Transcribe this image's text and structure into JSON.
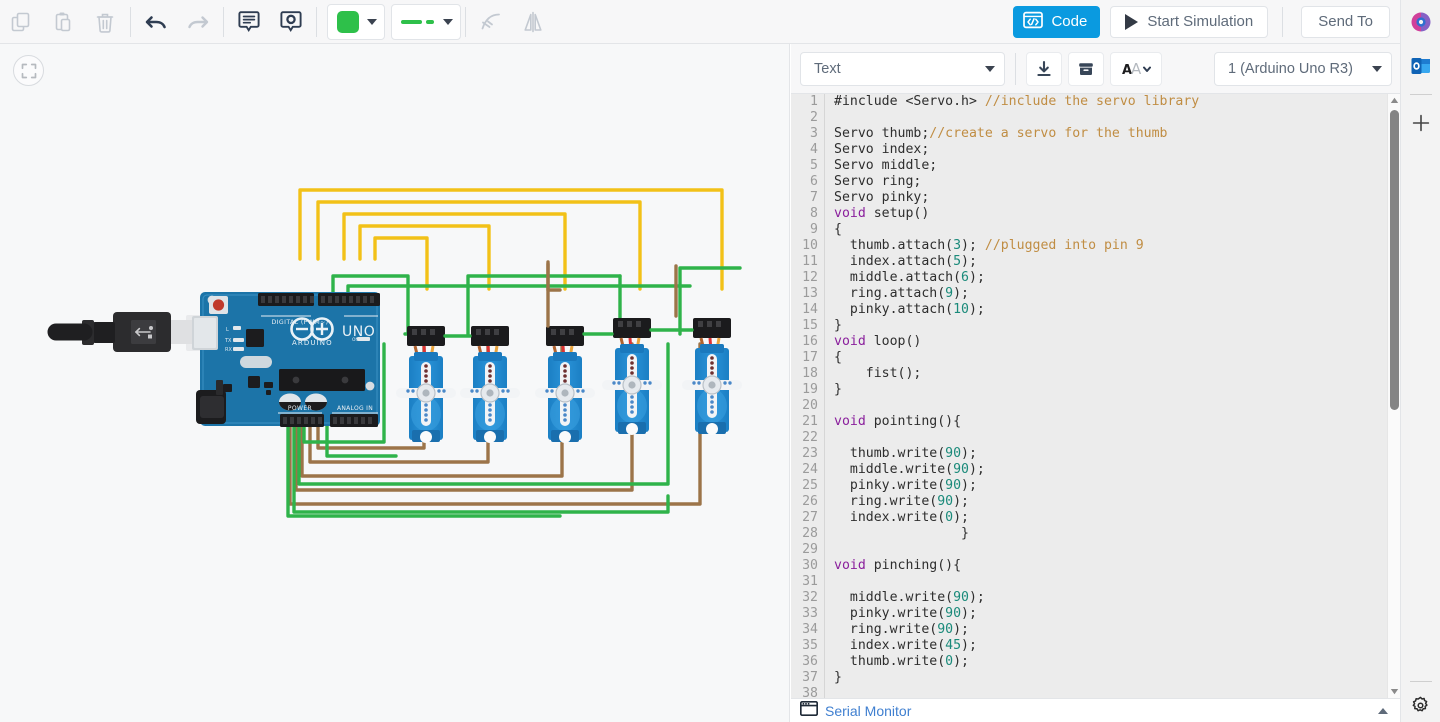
{
  "toolbar": {
    "left_tools": [
      {
        "name": "copy-icon",
        "title": "Copy"
      },
      {
        "name": "paste-icon",
        "title": "Paste"
      },
      {
        "name": "delete-icon",
        "title": "Delete"
      },
      {
        "name": "undo-icon",
        "title": "Undo"
      },
      {
        "name": "redo-icon",
        "title": "Redo"
      },
      {
        "name": "annotation-icon",
        "title": "Annotation"
      },
      {
        "name": "inspect-icon",
        "title": "Inspect"
      }
    ],
    "wire_color_hex": "#2ec04a",
    "right_tools": [
      {
        "name": "bend-wire-icon",
        "title": "Bend Wire"
      },
      {
        "name": "flip-icon",
        "title": "Flip"
      }
    ],
    "code_label": "Code",
    "start_simulation_label": "Start Simulation",
    "send_to_label": "Send To",
    "accent_hex": "#0a9ae0"
  },
  "canvas": {
    "fit_button_name": "fit-to-view",
    "board_label_brand": "ARDUINO",
    "board_label_model": "UNO",
    "board_header_digital": "DIGITAL (PWM~)",
    "board_header_power": "POWER",
    "board_header_analog": "ANALOG IN",
    "board_color_hex": "#1c74a8",
    "servo_color_hex": "#1b7fc4",
    "wire_signal_hex": "#f2c118",
    "wire_power_hex": "#2fb34a",
    "wire_ground_hex": "#9c7449",
    "servo_count": 5
  },
  "panel": {
    "mode_label": "Text",
    "download_icon": "download-icon",
    "library_icon": "library-icon",
    "font_size_icon": "font-size-icon",
    "board_selector_label": "1 (Arduino Uno R3)",
    "serial_monitor_label": "Serial Monitor"
  },
  "code": {
    "total_lines": 38,
    "lines": [
      {
        "n": 1,
        "tokens": [
          {
            "t": "#include <Servo.h> ",
            "c": ""
          },
          {
            "t": "//include the servo library",
            "c": "tok-cmt"
          }
        ]
      },
      {
        "n": 2,
        "tokens": [
          {
            "t": "",
            "c": ""
          }
        ]
      },
      {
        "n": 3,
        "tokens": [
          {
            "t": "Servo thumb;",
            "c": ""
          },
          {
            "t": "//create a servo for the thumb",
            "c": "tok-cmt"
          }
        ]
      },
      {
        "n": 4,
        "tokens": [
          {
            "t": "Servo index;",
            "c": ""
          }
        ]
      },
      {
        "n": 5,
        "tokens": [
          {
            "t": "Servo middle;",
            "c": ""
          }
        ]
      },
      {
        "n": 6,
        "tokens": [
          {
            "t": "Servo ring;",
            "c": ""
          }
        ]
      },
      {
        "n": 7,
        "tokens": [
          {
            "t": "Servo pinky;",
            "c": ""
          }
        ]
      },
      {
        "n": 8,
        "tokens": [
          {
            "t": "void",
            "c": "tok-kw"
          },
          {
            "t": " setup()",
            "c": ""
          }
        ]
      },
      {
        "n": 9,
        "tokens": [
          {
            "t": "{",
            "c": ""
          }
        ]
      },
      {
        "n": 10,
        "tokens": [
          {
            "t": "  thumb.attach(",
            "c": ""
          },
          {
            "t": "3",
            "c": "tok-num"
          },
          {
            "t": "); ",
            "c": ""
          },
          {
            "t": "//plugged into pin 9",
            "c": "tok-cmt"
          }
        ]
      },
      {
        "n": 11,
        "tokens": [
          {
            "t": "  index.attach(",
            "c": ""
          },
          {
            "t": "5",
            "c": "tok-num"
          },
          {
            "t": ");",
            "c": ""
          }
        ]
      },
      {
        "n": 12,
        "tokens": [
          {
            "t": "  middle.attach(",
            "c": ""
          },
          {
            "t": "6",
            "c": "tok-num"
          },
          {
            "t": ");",
            "c": ""
          }
        ]
      },
      {
        "n": 13,
        "tokens": [
          {
            "t": "  ring.attach(",
            "c": ""
          },
          {
            "t": "9",
            "c": "tok-num"
          },
          {
            "t": ");",
            "c": ""
          }
        ]
      },
      {
        "n": 14,
        "tokens": [
          {
            "t": "  pinky.attach(",
            "c": ""
          },
          {
            "t": "10",
            "c": "tok-num"
          },
          {
            "t": ");",
            "c": ""
          }
        ]
      },
      {
        "n": 15,
        "tokens": [
          {
            "t": "}",
            "c": ""
          }
        ]
      },
      {
        "n": 16,
        "tokens": [
          {
            "t": "void",
            "c": "tok-kw"
          },
          {
            "t": " loop()",
            "c": ""
          }
        ]
      },
      {
        "n": 17,
        "tokens": [
          {
            "t": "{",
            "c": ""
          }
        ]
      },
      {
        "n": 18,
        "tokens": [
          {
            "t": "    fist();",
            "c": ""
          }
        ]
      },
      {
        "n": 19,
        "tokens": [
          {
            "t": "}",
            "c": ""
          }
        ]
      },
      {
        "n": 20,
        "tokens": [
          {
            "t": "",
            "c": ""
          }
        ]
      },
      {
        "n": 21,
        "tokens": [
          {
            "t": "void",
            "c": "tok-kw"
          },
          {
            "t": " pointing(){",
            "c": ""
          }
        ]
      },
      {
        "n": 22,
        "tokens": [
          {
            "t": "",
            "c": ""
          }
        ]
      },
      {
        "n": 23,
        "tokens": [
          {
            "t": "  thumb.write(",
            "c": ""
          },
          {
            "t": "90",
            "c": "tok-num"
          },
          {
            "t": ");",
            "c": ""
          }
        ]
      },
      {
        "n": 24,
        "tokens": [
          {
            "t": "  middle.write(",
            "c": ""
          },
          {
            "t": "90",
            "c": "tok-num"
          },
          {
            "t": ");",
            "c": ""
          }
        ]
      },
      {
        "n": 25,
        "tokens": [
          {
            "t": "  pinky.write(",
            "c": ""
          },
          {
            "t": "90",
            "c": "tok-num"
          },
          {
            "t": ");",
            "c": ""
          }
        ]
      },
      {
        "n": 26,
        "tokens": [
          {
            "t": "  ring.write(",
            "c": ""
          },
          {
            "t": "90",
            "c": "tok-num"
          },
          {
            "t": ");",
            "c": ""
          }
        ]
      },
      {
        "n": 27,
        "tokens": [
          {
            "t": "  index.write(",
            "c": ""
          },
          {
            "t": "0",
            "c": "tok-num"
          },
          {
            "t": ");",
            "c": ""
          }
        ]
      },
      {
        "n": 28,
        "tokens": [
          {
            "t": "                }",
            "c": ""
          }
        ]
      },
      {
        "n": 29,
        "tokens": [
          {
            "t": "",
            "c": ""
          }
        ]
      },
      {
        "n": 30,
        "tokens": [
          {
            "t": "void",
            "c": "tok-kw"
          },
          {
            "t": " pinching(){",
            "c": ""
          }
        ]
      },
      {
        "n": 31,
        "tokens": [
          {
            "t": "",
            "c": ""
          }
        ]
      },
      {
        "n": 32,
        "tokens": [
          {
            "t": "  middle.write(",
            "c": ""
          },
          {
            "t": "90",
            "c": "tok-num"
          },
          {
            "t": ");",
            "c": ""
          }
        ]
      },
      {
        "n": 33,
        "tokens": [
          {
            "t": "  pinky.write(",
            "c": ""
          },
          {
            "t": "90",
            "c": "tok-num"
          },
          {
            "t": ");",
            "c": ""
          }
        ]
      },
      {
        "n": 34,
        "tokens": [
          {
            "t": "  ring.write(",
            "c": ""
          },
          {
            "t": "90",
            "c": "tok-num"
          },
          {
            "t": ");",
            "c": ""
          }
        ]
      },
      {
        "n": 35,
        "tokens": [
          {
            "t": "  index.write(",
            "c": ""
          },
          {
            "t": "45",
            "c": "tok-num"
          },
          {
            "t": ");",
            "c": ""
          }
        ]
      },
      {
        "n": 36,
        "tokens": [
          {
            "t": "  thumb.write(",
            "c": ""
          },
          {
            "t": "0",
            "c": "tok-num"
          },
          {
            "t": ");",
            "c": ""
          }
        ]
      },
      {
        "n": 37,
        "tokens": [
          {
            "t": "}",
            "c": ""
          }
        ]
      },
      {
        "n": 38,
        "tokens": [
          {
            "t": "",
            "c": ""
          }
        ]
      }
    ]
  },
  "rail": {
    "items": [
      {
        "name": "microsoft365-icon",
        "title": "Microsoft 365"
      },
      {
        "name": "outlook-icon",
        "title": "Outlook"
      },
      {
        "name": "add-icon",
        "title": "Add"
      }
    ],
    "settings_icon": "settings-gear-icon"
  }
}
